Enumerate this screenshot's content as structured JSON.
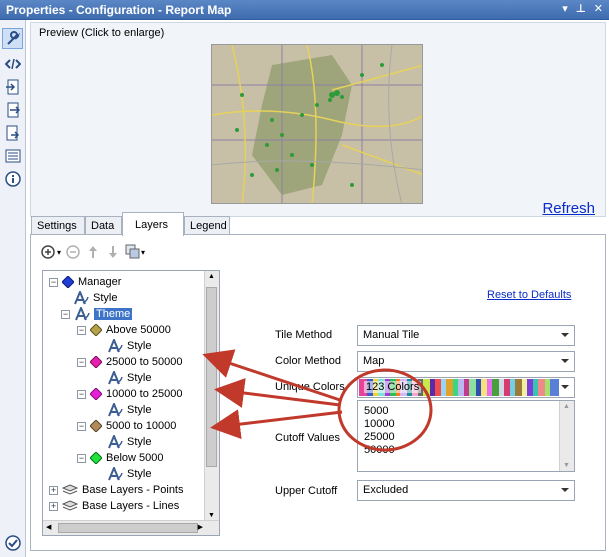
{
  "window": {
    "title": "Properties - Configuration - Report Map"
  },
  "sidebar": {
    "icons": [
      "wrench-icon",
      "code-icon",
      "input-icon",
      "output-icon",
      "export-icon",
      "list-icon",
      "info-icon",
      "check-icon"
    ]
  },
  "preview": {
    "label": "Preview (Click to enlarge)",
    "refresh_label": "Refresh"
  },
  "tabs": [
    {
      "label": "Settings"
    },
    {
      "label": "Data"
    },
    {
      "label": "Layers"
    },
    {
      "label": "Legend"
    }
  ],
  "tree": {
    "items": [
      {
        "label": "Manager",
        "icon": "diamond-blue-icon"
      },
      {
        "label": "Style",
        "icon": "style-icon"
      },
      {
        "label": "Theme",
        "icon": "style-icon"
      },
      {
        "label": "Above 50000",
        "icon": "diamond-olive-icon"
      },
      {
        "label": "Style",
        "icon": "style-icon"
      },
      {
        "label": "25000 to 50000",
        "icon": "diamond-magenta-icon"
      },
      {
        "label": "Style",
        "icon": "style-icon"
      },
      {
        "label": "10000 to 25000",
        "icon": "diamond-magenta-icon"
      },
      {
        "label": "Style",
        "icon": "style-icon"
      },
      {
        "label": "5000 to 10000",
        "icon": "diamond-brown-icon"
      },
      {
        "label": "Style",
        "icon": "style-icon"
      },
      {
        "label": "Below 5000",
        "icon": "diamond-green-icon"
      },
      {
        "label": "Style",
        "icon": "style-icon"
      },
      {
        "label": "Base Layers - Points",
        "icon": "layers-icon"
      },
      {
        "label": "Base Layers - Lines",
        "icon": "layers-icon"
      }
    ]
  },
  "settings": {
    "reset_label": "Reset to Defaults",
    "tile_method": {
      "label": "Tile Method",
      "value": "Manual Tile"
    },
    "color_method": {
      "label": "Color Method",
      "value": "Map"
    },
    "unique_colors": {
      "label": "Unique Colors",
      "value": "123 Colors"
    },
    "cutoff_values": {
      "label": "Cutoff Values",
      "values": [
        "5000",
        "10000",
        "25000",
        "50000"
      ]
    },
    "upper_cutoff": {
      "label": "Upper Cutoff",
      "value": "Excluded"
    }
  },
  "colors": {
    "titlebar": "#4a78bb",
    "selection": "#3d74c8",
    "annotation": "#c0392b",
    "link": "#0a2cc7"
  }
}
